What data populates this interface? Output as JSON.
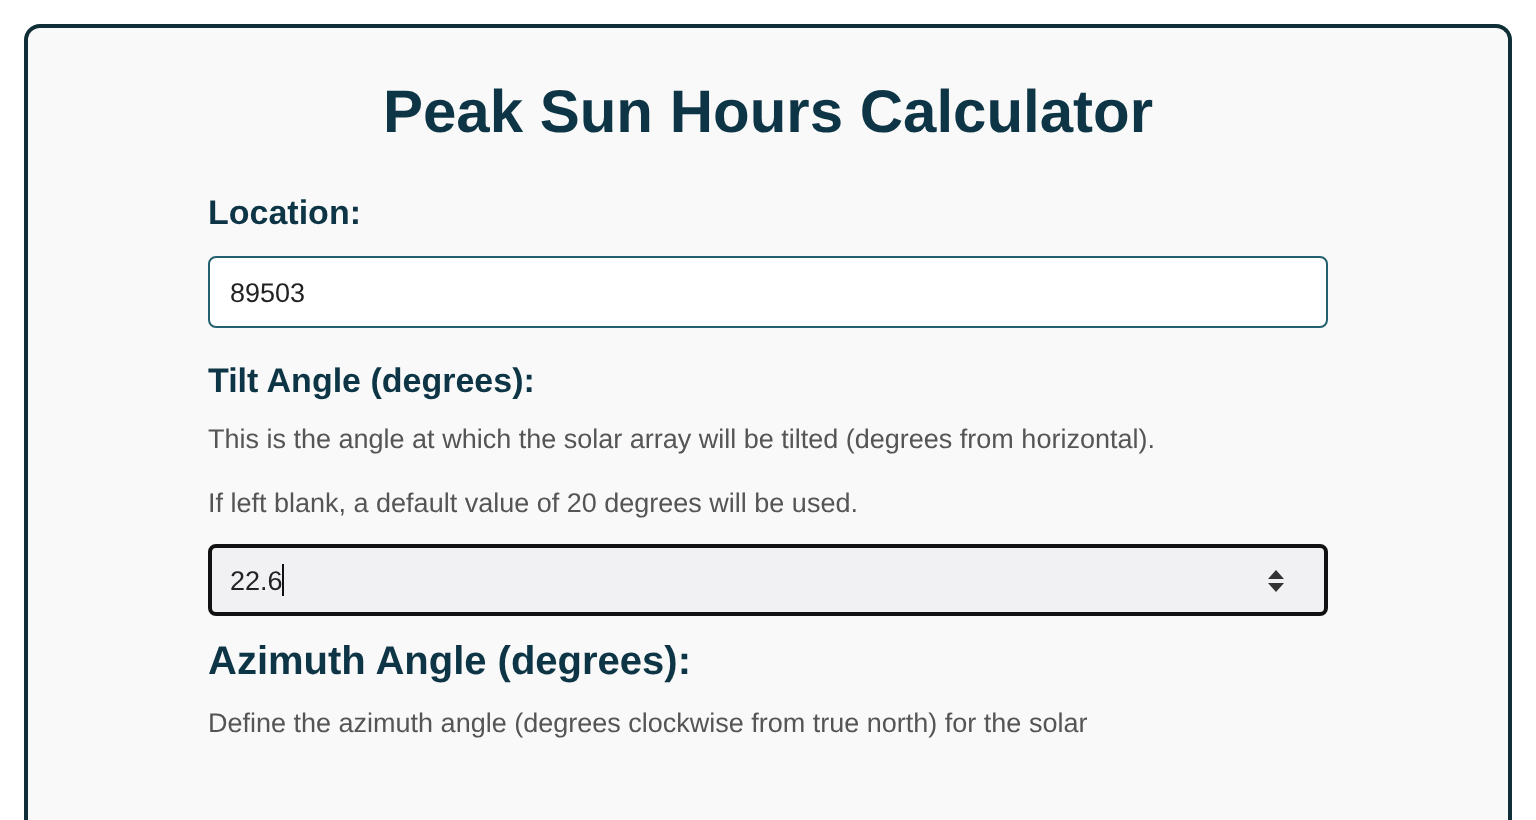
{
  "title": "Peak Sun Hours Calculator",
  "fields": [
    {
      "kind": "text",
      "label": "Location:",
      "value": "89503",
      "focused": false
    },
    {
      "kind": "number",
      "label": "Tilt Angle (degrees):",
      "help": [
        "This is the angle at which the solar array will be tilted (degrees from horizontal).",
        "If left blank, a default value of 20 degrees will be used."
      ],
      "value": "22.6",
      "focused": true
    },
    {
      "kind": "heading",
      "label": "Azimuth Angle (degrees):",
      "help": [
        "Define the azimuth angle (degrees clockwise from true north) for the solar"
      ]
    }
  ]
}
